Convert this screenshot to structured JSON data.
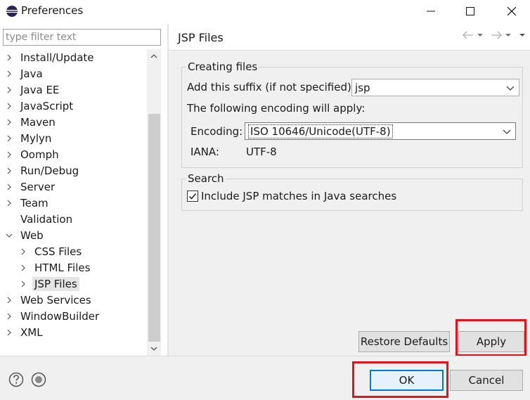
{
  "window": {
    "title": "Preferences",
    "icon": "eclipse-icon"
  },
  "filter": {
    "placeholder": "type filter text",
    "value": ""
  },
  "tree": {
    "items": [
      {
        "label": "Install/Update",
        "expanded": false,
        "level": 0
      },
      {
        "label": "Java",
        "expanded": false,
        "level": 0
      },
      {
        "label": "Java EE",
        "expanded": false,
        "level": 0
      },
      {
        "label": "JavaScript",
        "expanded": false,
        "level": 0
      },
      {
        "label": "Maven",
        "expanded": false,
        "level": 0
      },
      {
        "label": "Mylyn",
        "expanded": false,
        "level": 0
      },
      {
        "label": "Oomph",
        "expanded": false,
        "level": 0
      },
      {
        "label": "Run/Debug",
        "expanded": false,
        "level": 0
      },
      {
        "label": "Server",
        "expanded": false,
        "level": 0
      },
      {
        "label": "Team",
        "expanded": false,
        "level": 0
      },
      {
        "label": "Validation",
        "expanded": null,
        "level": 0
      },
      {
        "label": "Web",
        "expanded": true,
        "level": 0
      },
      {
        "label": "CSS Files",
        "expanded": false,
        "level": 1
      },
      {
        "label": "HTML Files",
        "expanded": false,
        "level": 1
      },
      {
        "label": "JSP Files",
        "expanded": false,
        "level": 1,
        "selected": true
      },
      {
        "label": "Web Services",
        "expanded": false,
        "level": 0
      },
      {
        "label": "WindowBuilder",
        "expanded": false,
        "level": 0
      },
      {
        "label": "XML",
        "expanded": false,
        "level": 0
      }
    ]
  },
  "page": {
    "title": "JSP Files",
    "creating": {
      "legend": "Creating files",
      "suffix_label": "Add this suffix (if not specified):",
      "suffix_value": "jsp",
      "encoding_note": "The following encoding will apply:",
      "encoding_label": "Encoding:",
      "encoding_value": "ISO 10646/Unicode(UTF-8)",
      "iana_label": "IANA:",
      "iana_value": "UTF-8"
    },
    "search": {
      "legend": "Search",
      "include_label": "Include JSP matches in Java searches",
      "include_checked": true
    },
    "restore_defaults_label": "Restore Defaults",
    "apply_label": "Apply"
  },
  "footer": {
    "ok_label": "OK",
    "cancel_label": "Cancel"
  },
  "colors": {
    "highlight_box": "#e0141e",
    "default_button_border": "#0078d7",
    "panel_bg": "#f0f0f0"
  }
}
